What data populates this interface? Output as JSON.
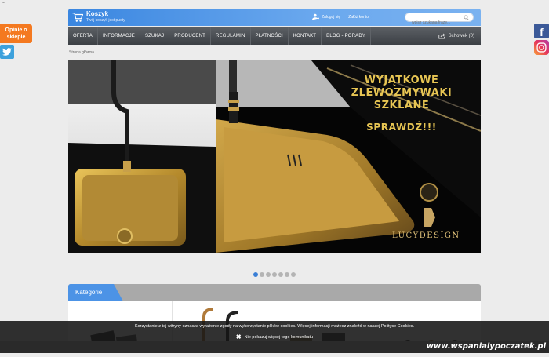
{
  "header": {
    "cart_title": "Koszyk",
    "cart_subtitle": "Twój koszyk jest pusty",
    "login": "Zaloguj się",
    "register": "Załóż konto",
    "search_placeholder": "wpisz szukaną frazę..."
  },
  "nav": {
    "items": [
      "OFERTA",
      "INFORMACJE",
      "SZUKAJ",
      "PRODUCENT",
      "REGULAMIN",
      "PŁATNOŚCI",
      "KONTAKT",
      "BLOG - PORADY"
    ],
    "schowek": "Schowek (0)"
  },
  "breadcrumb": "Strona główna",
  "banner": {
    "line1": "WYJĄTKOWE",
    "line2": "ZLEWOZMYWAKI",
    "line3": "SZKLANE",
    "cta": "SPRAWDŹ!!!",
    "brand": "LUCYDESIGN"
  },
  "slider": {
    "count": 7,
    "active": 0
  },
  "categories": {
    "title": "Kategorie"
  },
  "side": {
    "opinie": "Opinie o sklepie"
  },
  "cookie": {
    "text": "Korzystanie z tej witryny oznacza wyrażenie zgody na wykorzystanie plików cookies. Więcej informacji możesz znaleźć w naszej Polityce Cookies.",
    "accept": "Nie pokazuj więcej tego komunikatu"
  },
  "watermark": "www.wspanialypoczatek.pl",
  "colors": {
    "accent": "#3a86e0",
    "nav": "#45494e",
    "gold": "#e7c553",
    "opinie": "#f47920"
  }
}
